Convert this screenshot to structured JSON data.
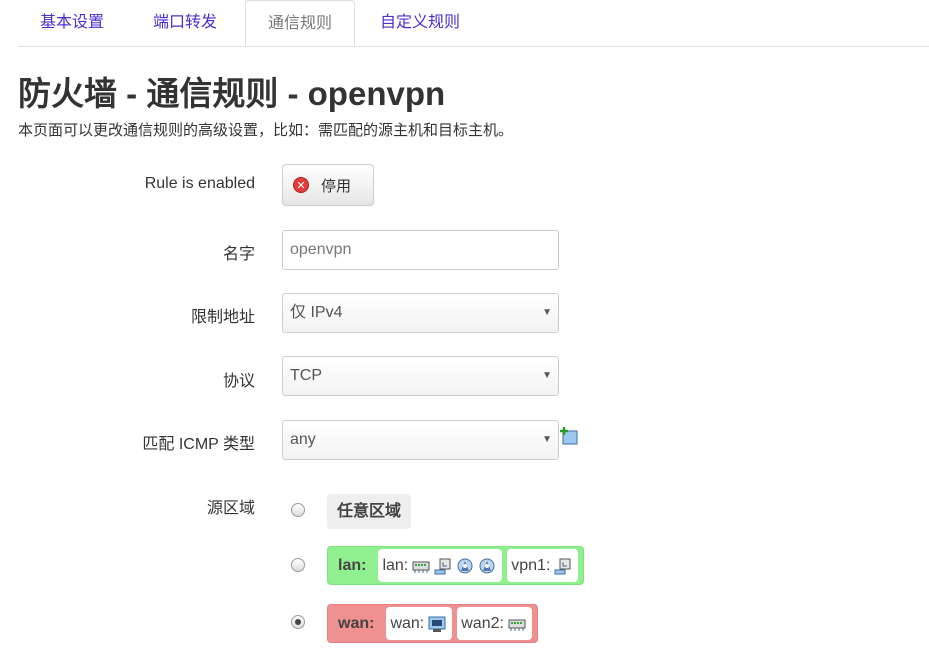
{
  "tabs": [
    {
      "label": "基本设置"
    },
    {
      "label": "端口转发"
    },
    {
      "label": "通信规则"
    },
    {
      "label": "自定义规则"
    }
  ],
  "title": "防火墙 - 通信规则 - openvpn",
  "description": "本页面可以更改通信规则的高级设置，比如：需匹配的源主机和目标主机。",
  "form": {
    "enabled_label": "Rule is enabled",
    "enabled_button": "停用",
    "name_label": "名字",
    "name_value": "openvpn",
    "family_label": "限制地址",
    "family_value": "仅 IPv4",
    "proto_label": "协议",
    "proto_value": "TCP",
    "icmp_label": "匹配 ICMP 类型",
    "icmp_value": "any",
    "source_zone_label": "源区域"
  },
  "zones": {
    "any_label": "任意区域",
    "lan": {
      "name": "lan:",
      "networks": [
        {
          "name": "lan:",
          "icons": [
            "switch-icon",
            "wifi-client-icon",
            "wifi-ap-icon",
            "wifi-ap-icon"
          ]
        },
        {
          "name": "vpn1:",
          "icons": [
            "wifi-client-icon"
          ]
        }
      ]
    },
    "wan": {
      "name": "wan:",
      "networks": [
        {
          "name": "wan:",
          "icons": [
            "ethernet-port-icon"
          ]
        },
        {
          "name": "wan2:",
          "icons": [
            "switch-icon"
          ]
        }
      ]
    },
    "selected": "wan"
  },
  "colors": {
    "tab_link": "#4a2fd0",
    "lan_zone": "#90f090",
    "wan_zone": "#f09090"
  }
}
